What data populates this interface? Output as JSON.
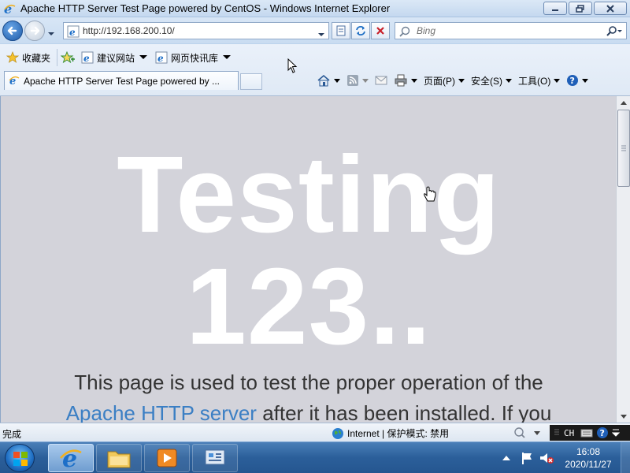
{
  "window": {
    "title": "Apache HTTP Server Test Page powered by CentOS - Windows Internet Explorer"
  },
  "address": {
    "url": "http://192.168.200.10/"
  },
  "search": {
    "placeholder": "Bing"
  },
  "favorites": {
    "favorites_label": "收藏夹",
    "items": [
      {
        "label": "建议网站",
        "icon": "ie-page-icon"
      },
      {
        "label": "网页快讯库",
        "icon": "ie-page-icon"
      }
    ]
  },
  "tab": {
    "label": "Apache HTTP Server Test Page powered by ..."
  },
  "commands": {
    "page": "页面(P)",
    "safety": "安全(S)",
    "tools": "工具(O)"
  },
  "page": {
    "hero": "Testing 123..",
    "intro_before": "This page is used to test the proper operation of the",
    "intro_link": "Apache HTTP server",
    "intro_after": " after it has been installed. If you"
  },
  "status": {
    "text": "完成",
    "zone": "Internet | 保护模式: 禁用",
    "lang": "CH"
  },
  "clock": {
    "time": "16:08",
    "date": "2020/11/27"
  },
  "colors": {
    "page_bg": "#d3d3da",
    "link": "#3b7fc4",
    "taskbar": "#2b5f9a"
  }
}
